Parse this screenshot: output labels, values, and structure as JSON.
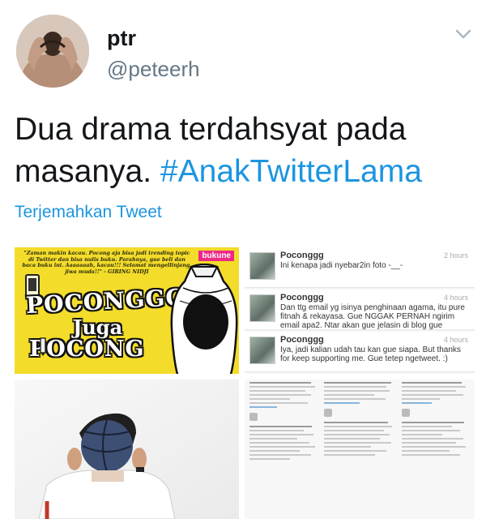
{
  "author": {
    "display_name": "ptr",
    "handle": "@peteerh"
  },
  "tweet": {
    "text": "Dua drama terdahsyat pada masanya. ",
    "hashtag": "#AnakTwitterLama",
    "translate_label": "Terjemahkan Tweet"
  },
  "colors": {
    "link": "#1b95e0",
    "secondary_text": "#657786",
    "primary_text": "#14171a"
  },
  "icons": {
    "menu": "chevron-down-icon"
  },
  "media": {
    "image1": {
      "caption": "\"Zaman makin kacau. Pocong aja bisa jadi trending topic di Twitter dan bisa nulis buku. Parahnya, gue beli dan baca buku ini. Aaaaaaah, kacau!!! Selamat mengellinjang, jiwa muda!!\" - GIRING NIDJI",
      "brand": "bukune",
      "title_line1": "POCONGGG",
      "title_line2": "Juga",
      "title_line3": "POCONG"
    },
    "image2": {
      "mentions": [
        {
          "user": "Poconggg",
          "time": "2 hours",
          "text": "Ini kenapa jadi nyebar2in foto -__-"
        },
        {
          "user": "Poconggg",
          "time": "4 hours",
          "text": "Dan ttg email yg isinya penghinaan agama, itu pure fitnah & rekayasa. Gue NGGAK PERNAH ngirim email apa2. Ntar akan gue jelasin di blog gue"
        },
        {
          "user": "Poconggg",
          "time": "4 hours",
          "text": "Iya, jadi kalian udah tau kan gue siapa. But thanks for keep supporting me. Gue tetep ngetweet. :)"
        }
      ]
    }
  }
}
